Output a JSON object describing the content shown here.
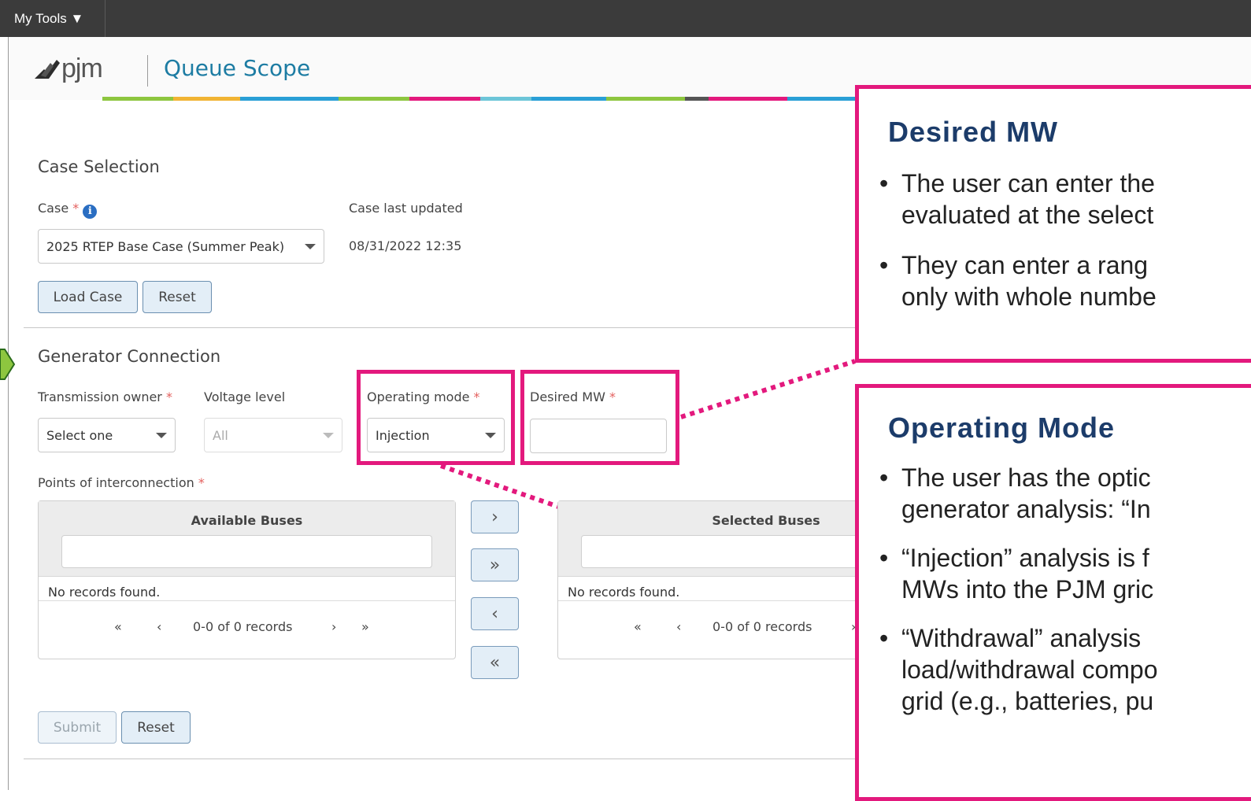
{
  "topbar": {
    "menu_label": "My Tools ▼"
  },
  "header": {
    "logo_text": "pjm",
    "app_title": "Queue Scope"
  },
  "case_selection": {
    "title": "Case Selection",
    "case_label": "Case",
    "required_mark": "*",
    "info_icon": "i",
    "case_value": "2025 RTEP Base Case (Summer Peak)",
    "last_updated_label": "Case last updated",
    "last_updated_value": "08/31/2022 12:35",
    "load_button": "Load Case",
    "reset_button": "Reset"
  },
  "generator_connection": {
    "title": "Generator Connection",
    "transmission_owner_label": "Transmission owner",
    "transmission_owner_value": "Select one",
    "voltage_level_label": "Voltage level",
    "voltage_level_value": "All",
    "operating_mode_label": "Operating mode",
    "operating_mode_value": "Injection",
    "desired_mw_label": "Desired MW",
    "desired_mw_value": "",
    "points_label": "Points of interconnection",
    "available_title": "Available Buses",
    "selected_title": "Selected Buses",
    "no_records": "No records found.",
    "pager_text": "0-0 of 0 records",
    "pager_first": "«",
    "pager_prev": "‹",
    "pager_next": "›",
    "pager_last": "»",
    "move_one_right": "›",
    "move_all_right": "»",
    "move_one_left": "‹",
    "move_all_left": "«",
    "submit_button": "Submit",
    "reset_button": "Reset"
  },
  "callouts": {
    "desired_mw": {
      "title": "Desired MW",
      "bullets": [
        "The user can enter the",
        "evaluated at the select",
        "They can enter a rang",
        "only with whole numbe"
      ]
    },
    "operating_mode": {
      "title": "Operating Mode",
      "bullets": [
        "The user has the optic",
        "generator analysis: “In",
        "“Injection” analysis is f",
        "MWs into the PJM gric",
        "“Withdrawal” analysis",
        "load/withdrawal compo",
        "grid (e.g., batteries, pu"
      ]
    },
    "bullet_char": "•"
  },
  "colors": {
    "accent": "#e3197d",
    "title_blue": "#1d7ca3",
    "callout_title": "#1c3c6a",
    "arrow_green": "#8dc63f"
  }
}
